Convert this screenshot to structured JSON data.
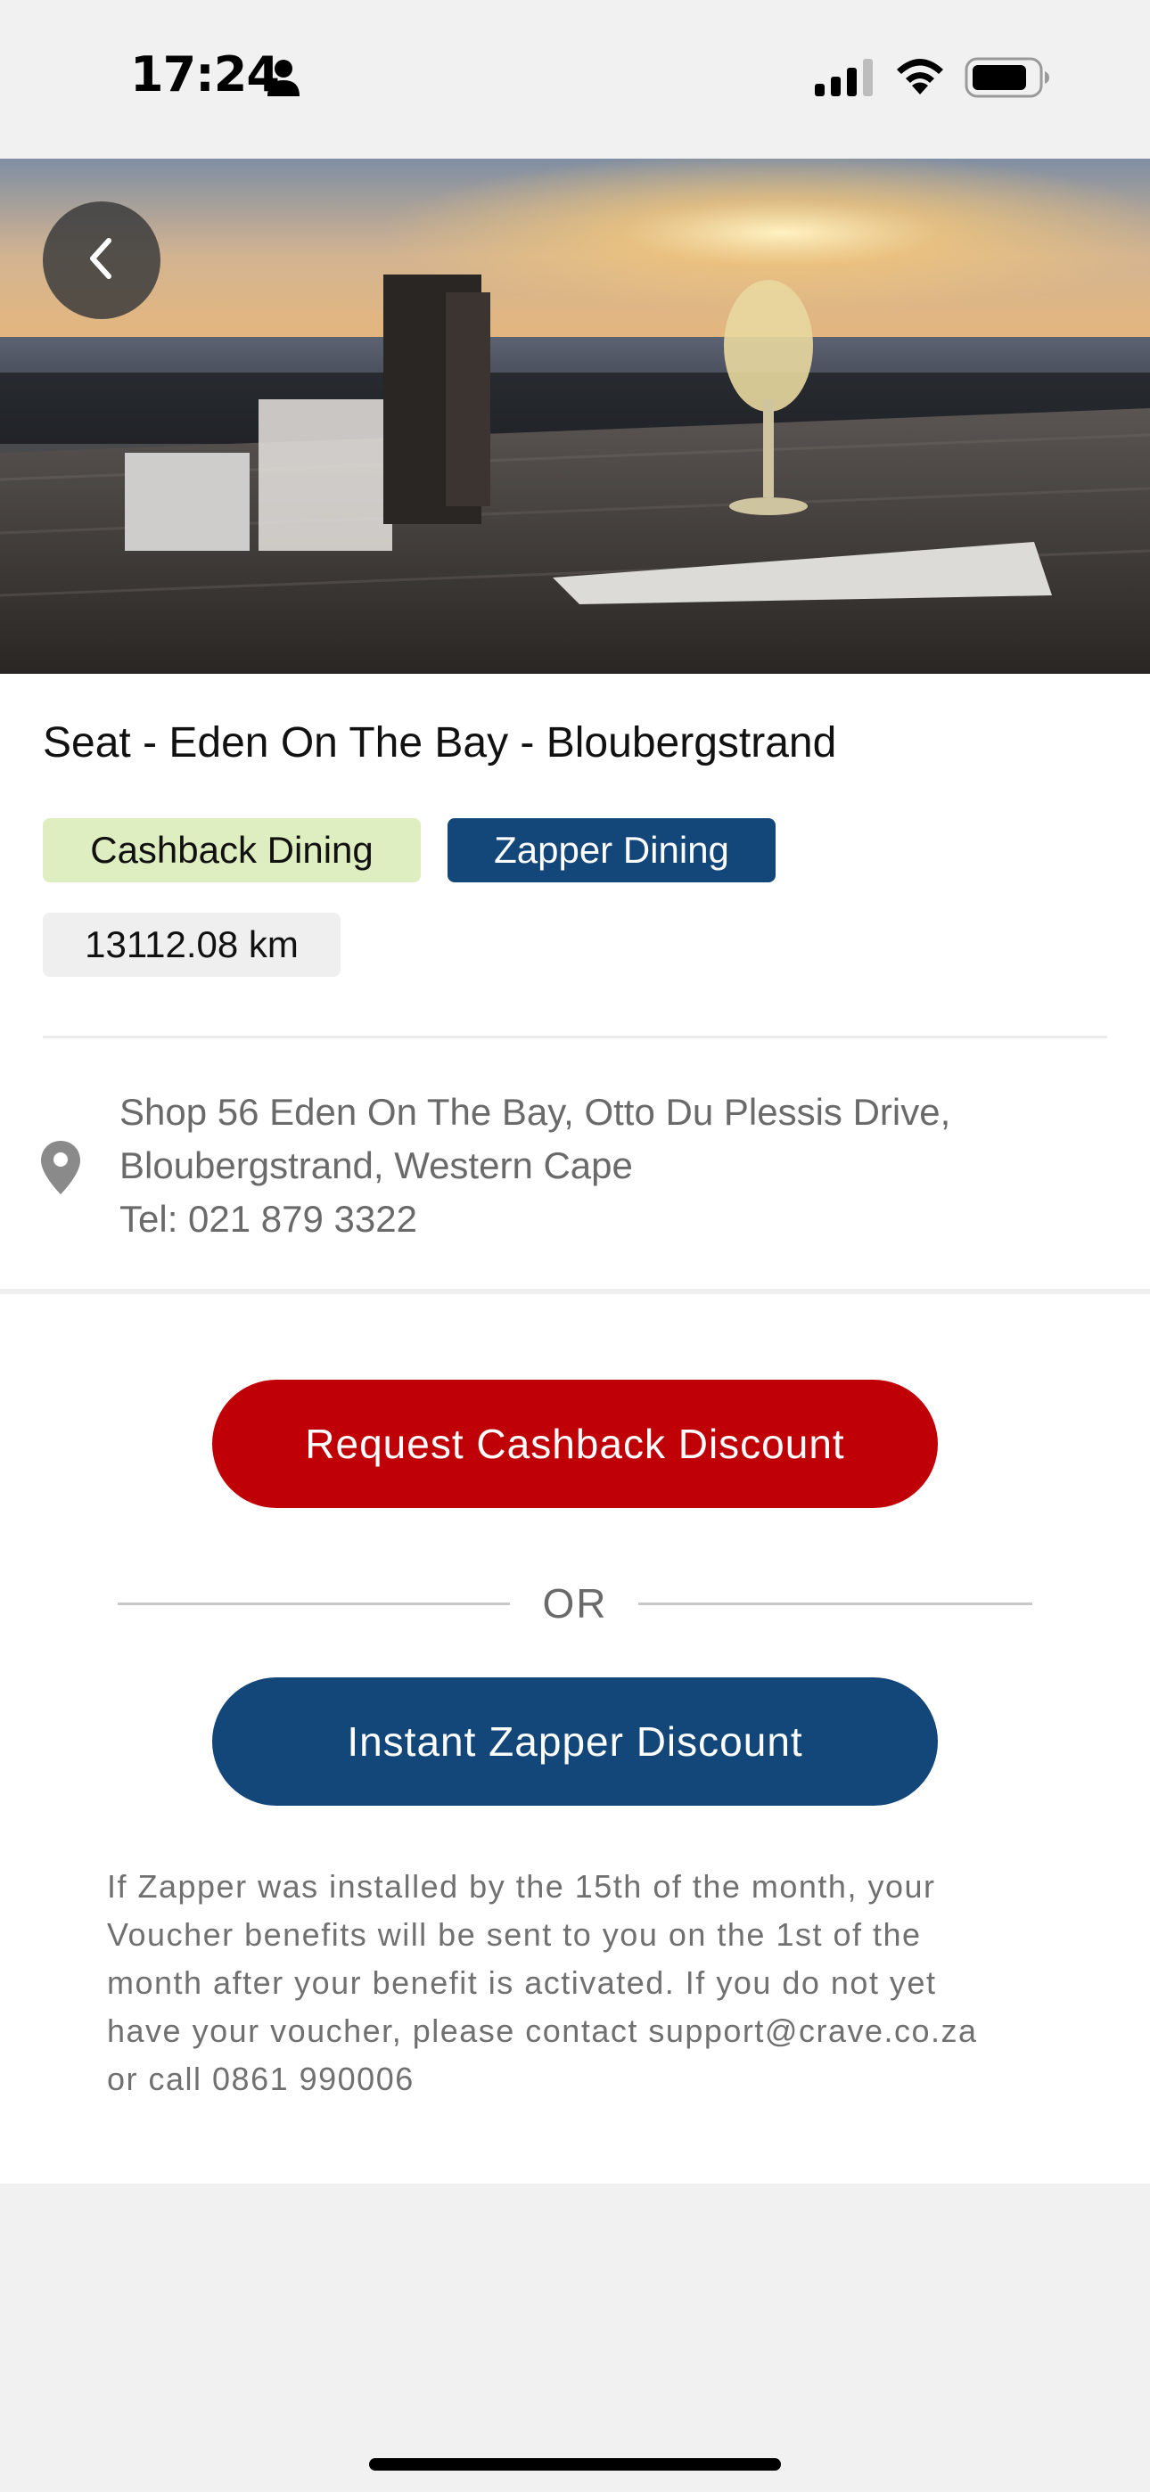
{
  "status_bar": {
    "time": "17:24",
    "icons": [
      "person-icon",
      "signal-icon",
      "wifi-icon",
      "battery-icon"
    ]
  },
  "hero": {
    "image": "sunset-table-wine-glass-photo",
    "back_icon": "chevron-left-icon"
  },
  "venue": {
    "title": "Seat - Eden On The Bay - Bloubergstrand",
    "tags": [
      {
        "label": "Cashback Dining",
        "color": "#dfeec0"
      },
      {
        "label": "Zapper Dining",
        "color": "#134679"
      }
    ],
    "distance": "13112.08 km",
    "address_icon": "location-pin-icon",
    "address_lines": [
      "Shop 56 Eden On The Bay, Otto Du Plessis Drive,",
      "Bloubergstrand, Western Cape",
      "Tel: 021 879 3322"
    ]
  },
  "actions": {
    "cashback_button": {
      "label": "Request Cashback Discount",
      "color": "#c00007"
    },
    "or_label": "OR",
    "zapper_button": {
      "label": "Instant Zapper Discount",
      "color": "#134679"
    }
  },
  "notice_lines": [
    "If Zapper was installed by the 15th of the month, your",
    "Voucher benefits will be sent to you on the 1st of the",
    "month after your benefit is activated. If you do not yet",
    "have your voucher, please contact support@crave.co.za",
    "or call 0861 990006"
  ]
}
